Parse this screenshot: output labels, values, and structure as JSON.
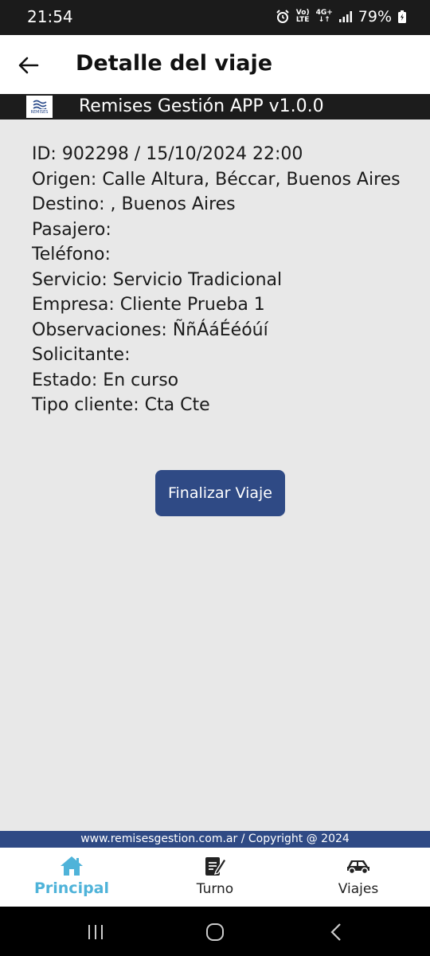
{
  "status_bar": {
    "time": "21:54",
    "battery_percent": "79%",
    "volte_label_top": "Vo)",
    "volte_label_bottom": "LTE",
    "network_label": "4G+"
  },
  "app_bar": {
    "title": "Detalle del viaje"
  },
  "brand": {
    "logo_text": "REMISES",
    "title": "Remises Gestión APP v1.0.0"
  },
  "details": [
    "ID: 902298 / 15/10/2024 22:00",
    "Origen: Calle Altura, Béccar, Buenos Aires",
    "Destino: , Buenos Aires",
    "Pasajero:",
    "Teléfono:",
    "Servicio: Servicio Tradicional",
    "Empresa: Cliente Prueba 1",
    "Observaciones: ÑñÁáÉéóúí",
    "Solicitante:",
    "Estado: En curso",
    "Tipo cliente: Cta Cte"
  ],
  "actions": {
    "finish_label": "Finalizar Viaje"
  },
  "footer": {
    "text": "www.remisesgestion.com.ar / Copyright @ 2024"
  },
  "bottom_nav": {
    "items": [
      {
        "label": "Principal",
        "icon": "home-icon",
        "active": true
      },
      {
        "label": "Turno",
        "icon": "edit-document-icon",
        "active": false
      },
      {
        "label": "Viajes",
        "icon": "car-icon",
        "active": false
      }
    ]
  },
  "colors": {
    "accent": "#2f4a85",
    "active_nav": "#4fb3d9",
    "background": "#e8e8e8"
  }
}
